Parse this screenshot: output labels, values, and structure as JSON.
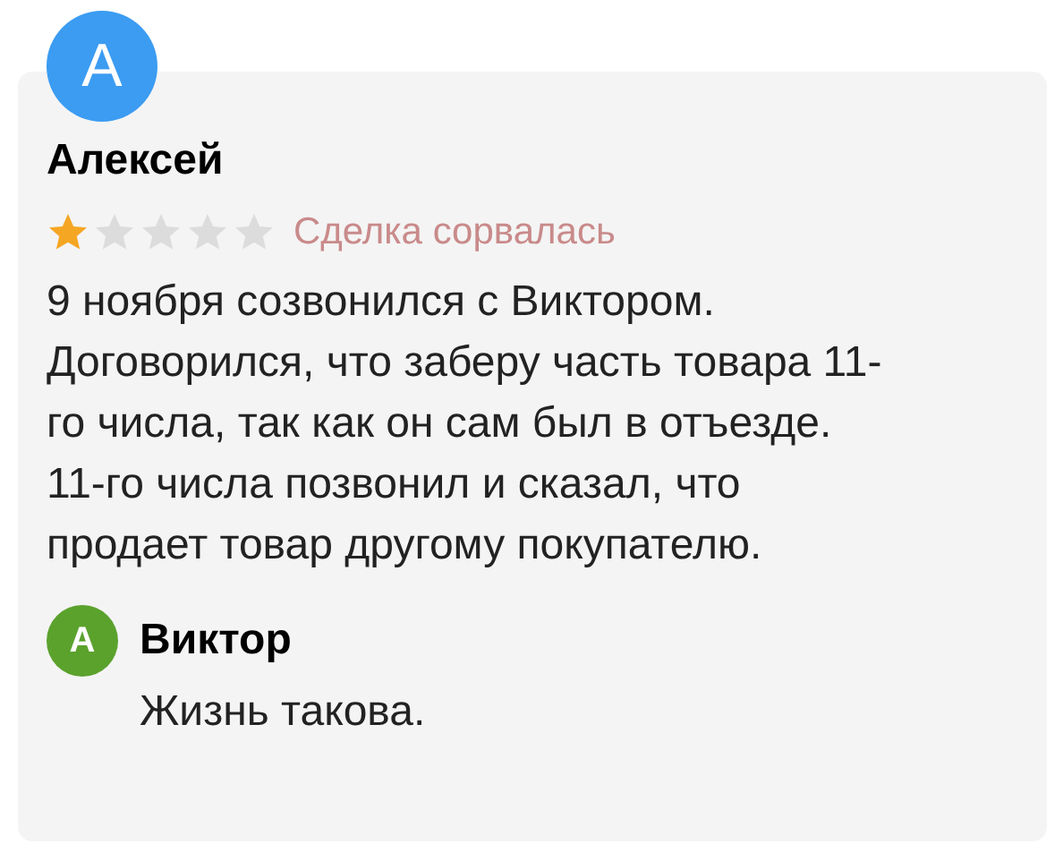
{
  "review": {
    "avatar_letter": "А",
    "author": "Алексей",
    "stars": 1,
    "status": "Сделка сорвалась",
    "text": "9 ноября созвонился с Виктором. Договорился, что заберу часть товара 11-го числа, так как он сам был в отъезде. 11-го числа позвонил и сказал, что продает товар другому покупателю."
  },
  "reply": {
    "avatar_letter": "А",
    "author": "Виктор",
    "text": "Жизнь такова."
  }
}
